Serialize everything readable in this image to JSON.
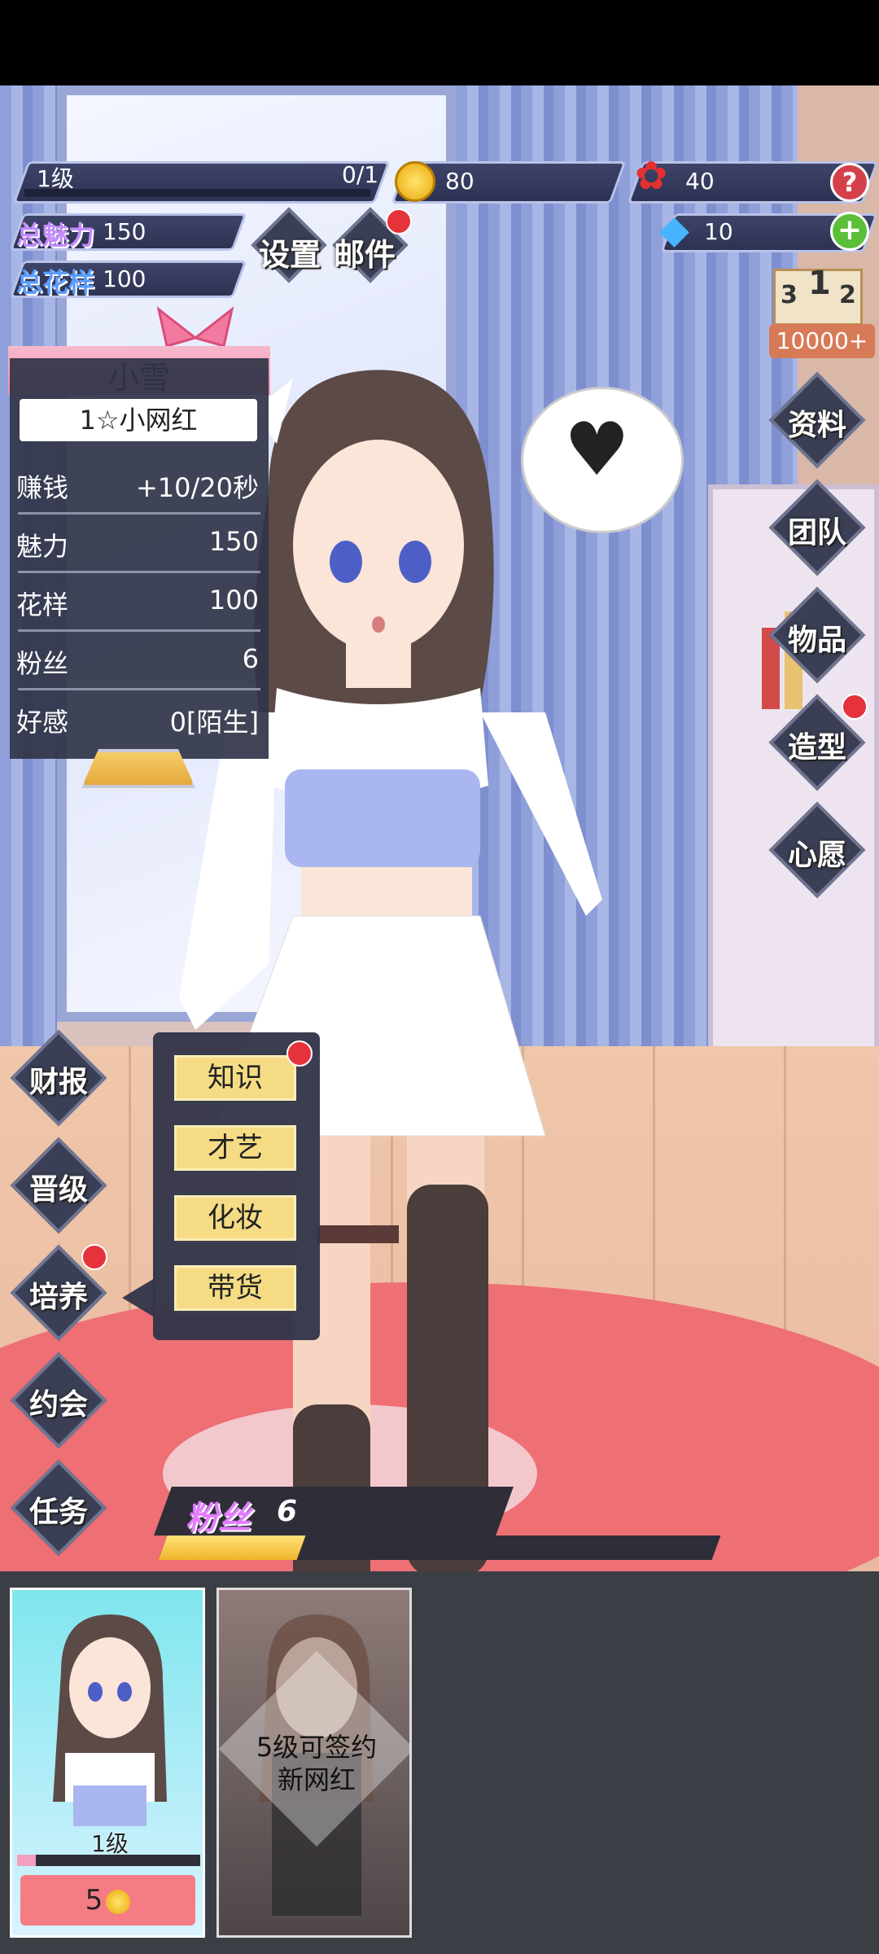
{
  "status_bar": {},
  "hud": {
    "level_label": "1级",
    "level_progress": "0/1",
    "coins": "80",
    "roses": "40",
    "diamonds": "10",
    "help_symbol": "?",
    "add_symbol": "+",
    "total_charm_label": "总魅力",
    "total_charm_value": "150",
    "total_pattern_label": "总花样",
    "total_pattern_value": "100",
    "settings_label": "设置",
    "mail_label": "邮件",
    "rank_places": [
      "3",
      "1",
      "2"
    ],
    "rank_value": "10000+"
  },
  "profile": {
    "name": "小雪",
    "title": "1☆小网红",
    "rows": [
      {
        "label": "赚钱",
        "value": "+10/20秒"
      },
      {
        "label": "魅力",
        "value": "150"
      },
      {
        "label": "花样",
        "value": "100"
      },
      {
        "label": "粉丝",
        "value": "6"
      },
      {
        "label": "好感",
        "value": "0[陌生]"
      }
    ]
  },
  "right_menu": [
    "资料",
    "团队",
    "物品",
    "造型",
    "心愿"
  ],
  "left_menu": [
    "财报",
    "晋级",
    "培养",
    "约会",
    "任务"
  ],
  "train_menu": [
    "知识",
    "才艺",
    "化妆",
    "带货"
  ],
  "fans_bar": {
    "label": "粉丝",
    "value": "6",
    "progress": 0.25
  },
  "bottom_cards": {
    "card1_level": "1级",
    "card1_price": "5",
    "card2_text_line1": "5级可签约",
    "card2_text_line2": "新网红"
  },
  "colors": {
    "accent_red": "#e5323b",
    "gold": "#f5c518",
    "panel_bg": "#303448"
  }
}
